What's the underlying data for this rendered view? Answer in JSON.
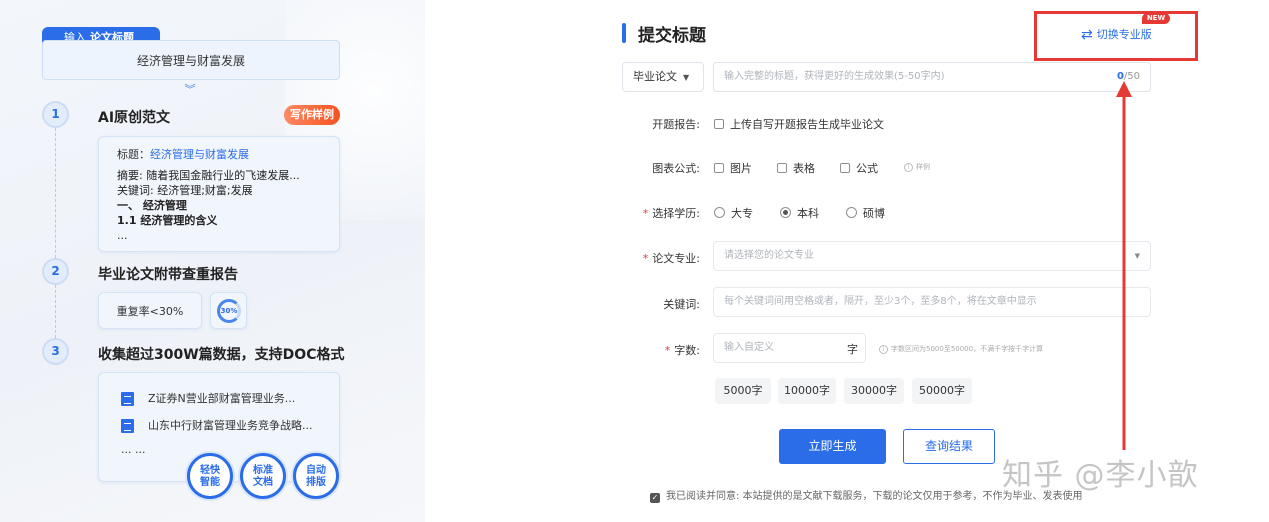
{
  "left": {
    "topic_tag_prefix": "输入",
    "topic_tag_bold": "论文标题",
    "topic_value": "经济管理与财富发展",
    "chevron": "︾",
    "steps": [
      {
        "num": "1",
        "title": "AI原创范文"
      },
      {
        "num": "2",
        "title": "毕业论文附带查重报告"
      },
      {
        "num": "3",
        "title": "收集超过300W篇数据，支持DOC格式"
      }
    ],
    "sample_badge": "写作样例",
    "sample": {
      "title_label": "标题：",
      "title_value": "经济管理与财富发展",
      "abstract": "摘要: 随着我国金融行业的飞速发展...",
      "keywords": "关键词: 经济管理;财富;发展",
      "section1": "一、 经济管理",
      "section1_1": "1.1 经济管理的含义",
      "ellipsis": "..."
    },
    "dup_rate": "重复率<30%",
    "ring_value": "30%",
    "docs": [
      "Z证券N营业部财富管理业务...",
      "山东中行财富管理业务竞争战略..."
    ],
    "docs_more": "... ...",
    "features": [
      [
        "轻快",
        "智能"
      ],
      [
        "标准",
        "文档"
      ],
      [
        "自动",
        "排版"
      ]
    ]
  },
  "right": {
    "title": "提交标题",
    "switch_label": "切换专业版",
    "switch_icon": "⇄",
    "new_badge": "NEW",
    "type_select": "毕业论文",
    "title_placeholder": "输入完整的标题，获得更好的生成效果(5-50字内)",
    "counter_current": "0",
    "counter_max": "/50",
    "opening_label": "开题报告:",
    "opening_option": "上传自写开题报告生成毕业论文",
    "chart_label": "图表公式:",
    "chart_options": [
      "图片",
      "表格",
      "公式"
    ],
    "chart_hint": "样例",
    "degree_label": "选择学历:",
    "degree_options": [
      "大专",
      "本科",
      "硕博"
    ],
    "degree_selected": "本科",
    "major_label": "论文专业:",
    "major_placeholder": "请选择您的论文专业",
    "keywords_label": "关键词:",
    "keywords_placeholder": "每个关键词间用空格或者，隔开，至少3个，至多8个，将在文章中显示",
    "words_label": "字数:",
    "words_placeholder": "输入自定义",
    "words_unit": "字",
    "words_hint": "字数区间为5000至50000，不满千字按千字计算",
    "word_chips": [
      "5000字",
      "10000字",
      "30000字",
      "50000字"
    ],
    "generate_button": "立即生成",
    "query_button": "查询结果",
    "agree_text": "我已阅读并同意: 本站提供的是文献下载服务，下载的论文仅用于参考，不作为毕业、发表使用",
    "watermark": "知乎 @李小歆"
  },
  "colors": {
    "accent": "#2b6de8",
    "highlight": "#e53935"
  }
}
